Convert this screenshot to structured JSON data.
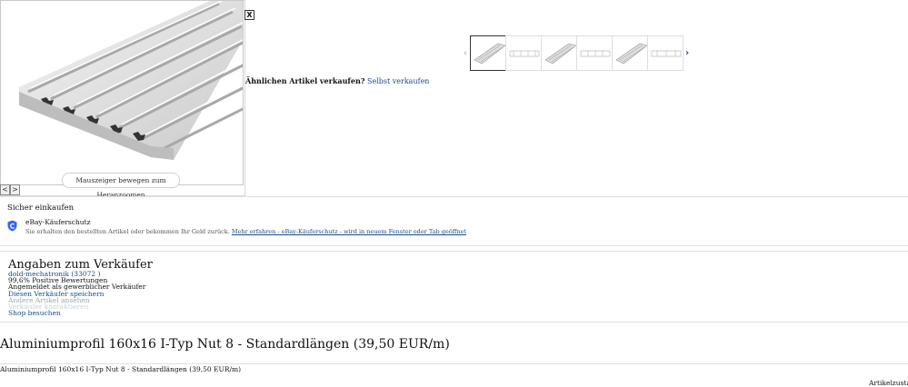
{
  "gallery": {
    "zoom_hint": "Mauszeiger bewegen zum Heranzoomen",
    "close_label": "X",
    "prev_label": "<",
    "next_label": ">",
    "thumb_prev": "‹",
    "thumb_next": "›",
    "thumbnail_count": 6,
    "image_icon": "aluminium-profile-image"
  },
  "sell_similar": {
    "question": "Ähnlichen Artikel verkaufen?",
    "link": "Selbst verkaufen"
  },
  "buyer_protection": {
    "heading": "Sicher einkaufen",
    "title": "eBay-Käuferschutz",
    "text": "Sie erhalten den bestellten Artikel oder bekommen Ihr Geld zurück.",
    "link": "Mehr erfahren - eBay-Käuferschutz - wird in neuem Fenster oder Tab geöffnet",
    "icon": "shield-icon",
    "icon_color": "#3665f3"
  },
  "seller": {
    "heading": "Angaben zum Verkäufer",
    "name": "dold-mechatronik (33072 )",
    "rating": "99,6% Positive Bewertungen",
    "status": "Angemeldet als gewerblicher Verkäufer",
    "save": "Diesen Verkäufer speichern",
    "other_items": "Andere Artikel ansehen",
    "contact": "Verkäufer kontaktieren",
    "shop": "Shop besuchen"
  },
  "item": {
    "title": "Aluminiumprofil 160x16 I-Typ Nut 8 - Standardlängen (39,50 EUR/m)",
    "subtitle": "Aluminiumprofil 160x16 I-Typ Nut 8 - Standardlängen (39,50 EUR/m)",
    "condition_label": "Artikelzustand"
  },
  "colors": {
    "link": "#1a4b8a",
    "divider": "#e0e0e0"
  }
}
